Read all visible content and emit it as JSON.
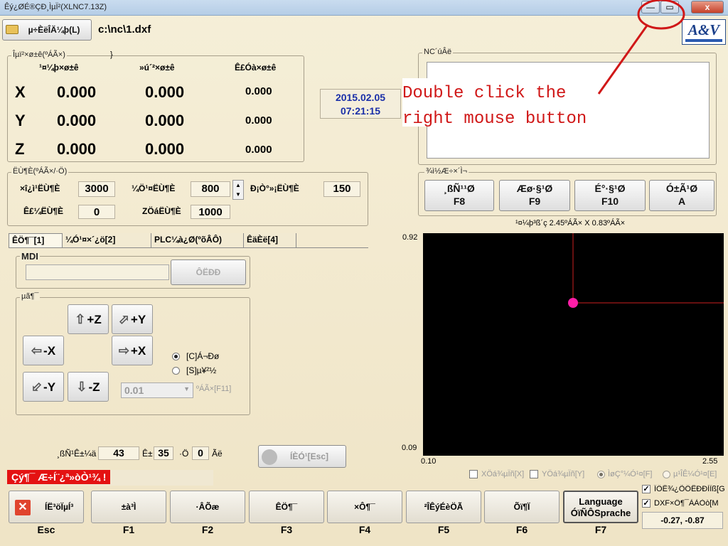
{
  "window": {
    "title": "Êý¿ØÉ®ÇÐ¸ÌµÏ²(XLNC7.13Z)",
    "minimize": "—",
    "maximize": "▭",
    "close": "x"
  },
  "toolbar": {
    "open_button": "µ÷ÈëÎÄ¼þ(L)",
    "file_path": "c:\\nc\\1.dxf"
  },
  "logo": {
    "text": "A&V"
  },
  "coords": {
    "group_label": "Îµï²×ø±ê(ºÁÃ×)",
    "headers": [
      "¹¤¼þ×ø±ê",
      "»ú´²×ø±ê",
      "Ê£Óà×ø±ê"
    ],
    "rows": [
      {
        "axis": "X",
        "work": "0.000",
        "machine": "0.000",
        "remain": "0.000"
      },
      {
        "axis": "Y",
        "work": "0.000",
        "machine": "0.000",
        "remain": "0.000"
      },
      {
        "axis": "Z",
        "work": "0.000",
        "machine": "0.000",
        "remain": "0.000"
      }
    ]
  },
  "datetime": {
    "date": "2015.02.05",
    "time": "07:21:15"
  },
  "nc_code": {
    "label": "NC´úÂë"
  },
  "annotation": {
    "line1": "Double click the",
    "line2": "right mouse button"
  },
  "speed": {
    "group_label": "ËÙ¶È(ºÁÃ×/·Ö)",
    "max_label": "×î¿ì¹ËÙ¶È",
    "max_value": "3000",
    "manual_label": "¼Ö¹¤ËÙ¶È",
    "manual_value": "800",
    "point_label": "Ð¡Ò°»¡ËÙ¶È",
    "point_value": "150",
    "current_label": "Ê£¼ËÙ¶È",
    "current_value": "0",
    "z_label": "ZÖáËÙ¶È",
    "z_value": "1000"
  },
  "simulation": {
    "group_label": "¾ì½Æ÷×´Ì¬",
    "buttons": [
      {
        "name": "¸ßÑ¹¹Ø",
        "key": "F8"
      },
      {
        "name": "Æø·§¹Ø",
        "key": "F9"
      },
      {
        "name": "É°·§¹Ø",
        "key": "F10"
      },
      {
        "name": "Ó±Ã¹Ø",
        "key": "A"
      }
    ],
    "size_info": "¹¤¼þ³ß´ç 2.45ºÁÃ× X 0.83ºÁÃ×"
  },
  "tabs": [
    "ÊÖ¶¯[1]",
    "¼Ó¹¤×´¿ö[2]",
    "PLC¼à¿Ø(ºõÂÔ)",
    "ÊäÈë[4]"
  ],
  "mdi": {
    "label": "MDI",
    "input_value": "",
    "run_button": "ÔËÐÐ"
  },
  "jog": {
    "group_label": "µã¶¯",
    "buttons": {
      "z_plus": "+Z",
      "y_plus": "+Y",
      "x_minus": "-X",
      "x_plus": "+X",
      "y_minus": "-Y",
      "z_minus": "-Z"
    },
    "mode_continuous": "[C]Á¬Ðø",
    "mode_step": "[S]µ¥²½",
    "step_value": "0.01",
    "step_hint": "ºÁÃ×[F11]"
  },
  "counters": {
    "label": "¸ßÑ¹Ê±¼ä",
    "value1": "43",
    "unit1": "Ê±",
    "value2": "35",
    "unit2": "·Ö",
    "value3": "0",
    "unit3": "Ãë"
  },
  "stop_button": "ÍÈÓ¹[Esc]",
  "status_message": "Çý¶¯ Æ÷Í¨¿ª»òÒ¹¾ !",
  "plot": {
    "y_top": "0.92",
    "y_bottom": "0.09",
    "x_left": "0.10",
    "x_right": "2.55",
    "opt_x_mirror": "XÖá¾µÏñ[X]",
    "opt_y_mirror": "YÖá¾µÏñ[Y]",
    "opt_screen": "ÌøÇ°¼Ó¹¤[F]",
    "opt_flip": "µ¹ÎÊ¼Ó¹¤[E]",
    "opt_coords": "ÏÔÊ¾¿ÕÔÊÐÐÍÏß[G",
    "opt_dxf": "DXF×Ô¶¯ÀÀÒò[M",
    "cursor_coords": "-0.27,  -0.87",
    "point_color": "#ff1ea8",
    "line_color": "#cc1f1f"
  },
  "function_keys": [
    {
      "label": "ÍË³öÏµÍ³",
      "key": "Esc"
    },
    {
      "label": "±à³Ì",
      "key": "F1"
    },
    {
      "label": "·ÂÕæ",
      "key": "F2"
    },
    {
      "label": "ÊÖ¶¯",
      "key": "F3"
    },
    {
      "label": "×Ô¶¯",
      "key": "F4"
    },
    {
      "label": "²ÎÊýÉèÖÃ",
      "key": "F5"
    },
    {
      "label": "Õï¶Ï",
      "key": "F6"
    },
    {
      "label": "Language ÓïÑÔSprache",
      "key": "F7"
    }
  ]
}
